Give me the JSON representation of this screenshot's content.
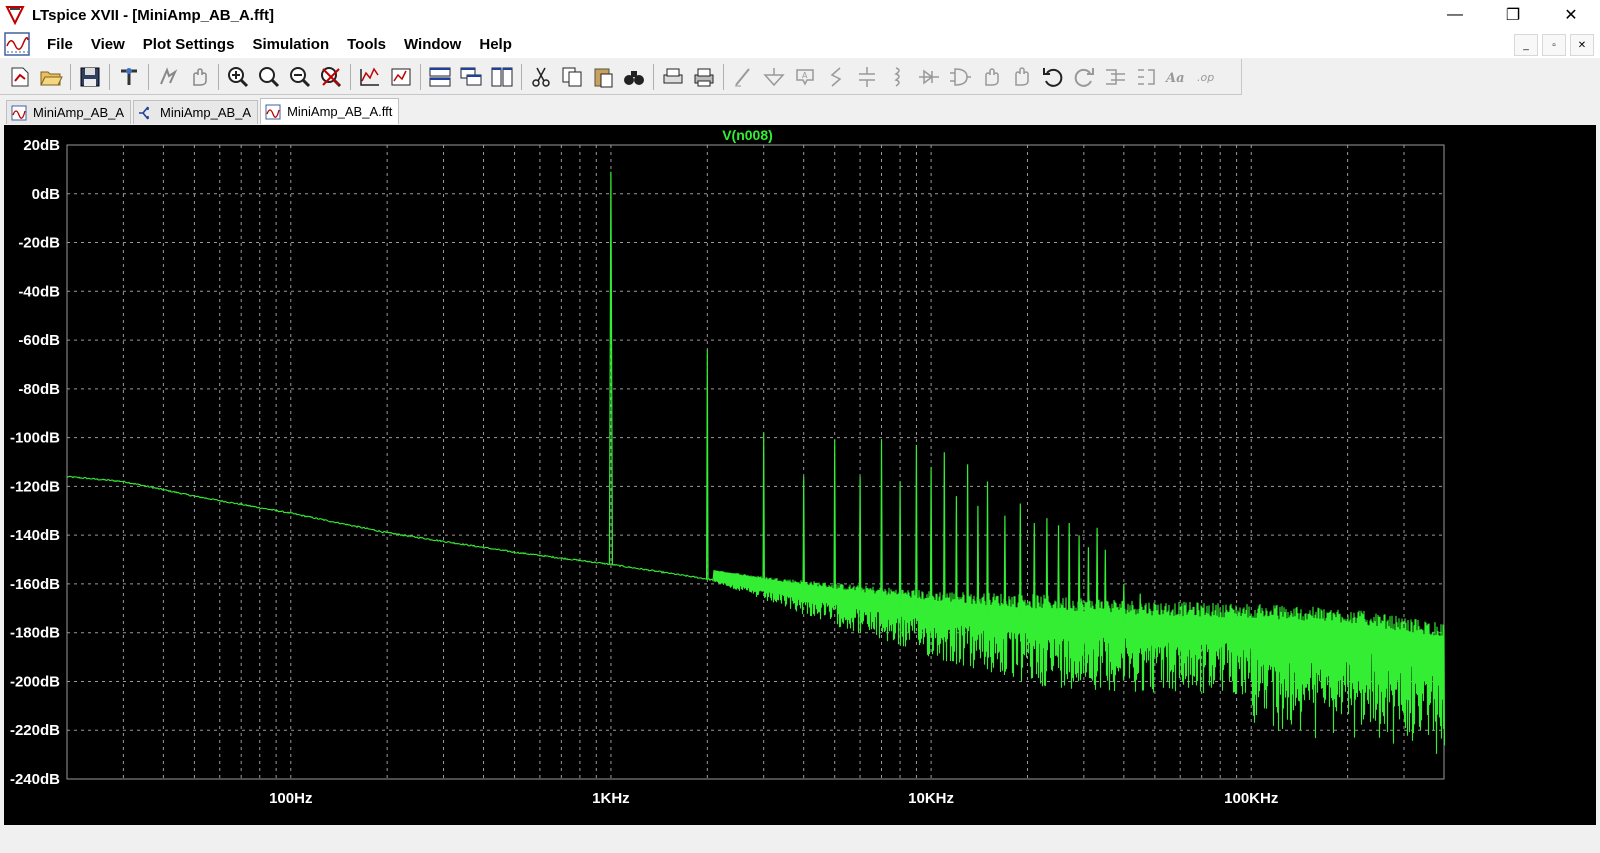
{
  "window": {
    "title": "LTspice XVII - [MiniAmp_AB_A.fft]",
    "minimize": "—",
    "maximize": "❐",
    "close": "✕"
  },
  "menu": [
    "File",
    "View",
    "Plot Settings",
    "Simulation",
    "Tools",
    "Window",
    "Help"
  ],
  "mdi": {
    "minimize": "_",
    "restore": "▫",
    "close": "✕"
  },
  "toolbar": {
    "groups": [
      [
        "new-schematic-icon",
        "open-icon"
      ],
      [
        "save-icon"
      ],
      [
        "control-panel-icon"
      ],
      [
        "run-icon",
        "halt-icon"
      ],
      [
        "zoom-in-icon",
        "zoom-full-icon",
        "zoom-out-icon",
        "zoom-cancel-icon"
      ],
      [
        "autorange-icon",
        "edit-axis-icon"
      ],
      [
        "tile-horizontal-icon",
        "cascade-icon",
        "tile-vertical-icon"
      ],
      [
        "cut-icon",
        "copy-icon",
        "paste-icon",
        "find-icon"
      ],
      [
        "print-preview-icon",
        "print-icon"
      ],
      [
        "draw-wire-icon",
        "ground-icon",
        "label-icon",
        "resistor-icon",
        "capacitor-icon",
        "inductor-icon",
        "diode-icon",
        "component-icon",
        "move-icon",
        "drag-icon",
        "undo-icon",
        "redo-icon",
        "rotate-icon",
        "mirror-icon",
        "text-icon",
        "spice-directive-icon"
      ]
    ],
    "text_icon_label": "Aa",
    "op_icon_label": ".op"
  },
  "tabs": [
    {
      "label": "MiniAmp_AB_A",
      "icon": "waveform-icon",
      "active": false
    },
    {
      "label": "MiniAmp_AB_A",
      "icon": "schematic-icon",
      "active": false
    },
    {
      "label": "MiniAmp_AB_A.fft",
      "icon": "waveform-icon",
      "active": true
    }
  ],
  "colors": {
    "trace": "#33ee33",
    "grid": "#9a9a9a",
    "axis_label": "#ffffff",
    "trace_title": "#33ee33",
    "plot_bg": "#000000"
  },
  "chart_data": {
    "type": "line",
    "title": "V(n008)",
    "xscale": "log",
    "xlim": [
      20,
      400000
    ],
    "ylim": [
      -240,
      20
    ],
    "yticks": [
      20,
      0,
      -20,
      -40,
      -60,
      -80,
      -100,
      -120,
      -140,
      -160,
      -180,
      -200,
      -220,
      -240
    ],
    "ytick_labels": [
      "20dB",
      "0dB",
      "-20dB",
      "-40dB",
      "-60dB",
      "-80dB",
      "-100dB",
      "-120dB",
      "-140dB",
      "-160dB",
      "-180dB",
      "-200dB",
      "-220dB",
      "-240dB"
    ],
    "xticks": [
      100,
      1000,
      10000,
      100000
    ],
    "xtick_labels": [
      "100Hz",
      "1KHz",
      "10KHz",
      "100KHz"
    ],
    "grid": true,
    "series": [
      {
        "name": "V(n008)",
        "noise_floor": [
          [
            20,
            -116
          ],
          [
            30,
            -118
          ],
          [
            50,
            -124
          ],
          [
            100,
            -131
          ],
          [
            200,
            -139
          ],
          [
            500,
            -147
          ],
          [
            1000,
            -152
          ],
          [
            2000,
            -158
          ],
          [
            3000,
            -162
          ],
          [
            5000,
            -166
          ],
          [
            10000,
            -171
          ],
          [
            20000,
            -174
          ],
          [
            50000,
            -177
          ],
          [
            100000,
            -178
          ],
          [
            200000,
            -180
          ],
          [
            400000,
            -186
          ]
        ],
        "harmonics": [
          [
            1000,
            9
          ],
          [
            2000,
            -64
          ],
          [
            3000,
            -98
          ],
          [
            4000,
            -116
          ],
          [
            5000,
            -101
          ],
          [
            6000,
            -116
          ],
          [
            7000,
            -101
          ],
          [
            8000,
            -118
          ],
          [
            9000,
            -103
          ],
          [
            10000,
            -112
          ],
          [
            11000,
            -106
          ],
          [
            12000,
            -124
          ],
          [
            13000,
            -111
          ],
          [
            14000,
            -128
          ],
          [
            15000,
            -118
          ],
          [
            17000,
            -132
          ],
          [
            19000,
            -127
          ],
          [
            21000,
            -135
          ],
          [
            23000,
            -133
          ],
          [
            25000,
            -136
          ],
          [
            27000,
            -135
          ],
          [
            29000,
            -140
          ],
          [
            31000,
            -145
          ],
          [
            33000,
            -137
          ],
          [
            35000,
            -146
          ],
          [
            40000,
            -160
          ],
          [
            45000,
            -164
          ]
        ]
      }
    ]
  }
}
